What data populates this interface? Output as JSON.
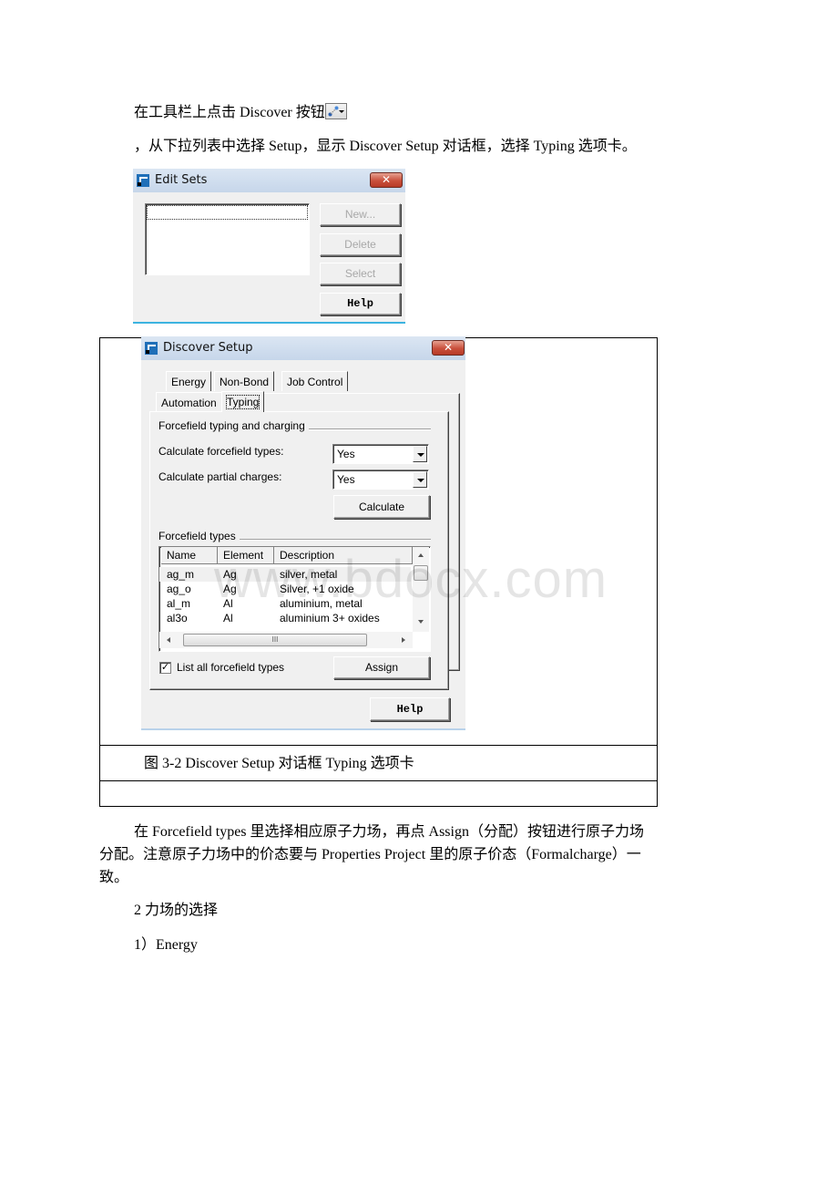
{
  "doc": {
    "para1": "在工具栏上点击 Discover 按钮",
    "para1_icon": "discover-toolbar-icon",
    "para2": "，从下拉列表中选择 Setup，显示 Discover Setup 对话框，选择 Typing 选项卡。",
    "caption": "图 3-2  Discover Setup 对话框 Typing 选项卡",
    "para3_line1": "在 Forcefield types 里选择相应原子力场，再点 Assign（分配）按钮进行原子力场",
    "para3_line2": "分配。注意原子力场中的价态要与 Properties Project 里的原子价态（Formalcharge）一",
    "para3_line3": "致。",
    "heading2": "2 力场的选择",
    "heading3": "1）Energy",
    "watermark": "www.bdocx.com"
  },
  "edit_sets": {
    "title": "Edit Sets",
    "close_glyph": "✕",
    "buttons": {
      "new": "New...",
      "delete": "Delete",
      "select": "Select",
      "help": "Help"
    }
  },
  "discover_setup": {
    "title": "Discover Setup",
    "close_glyph": "✕",
    "tabs_back": [
      "Energy",
      "Non-Bond",
      "Job Control"
    ],
    "tabs_front": [
      "Automation",
      "Typing"
    ],
    "selected_tab": "Typing",
    "group1_label": "Forcefield typing and charging",
    "calc_types_label": "Calculate forcefield types:",
    "calc_types_value": "Yes",
    "calc_charges_label": "Calculate partial charges:",
    "calc_charges_value": "Yes",
    "calculate_button": "Calculate",
    "group2_label": "Forcefield types",
    "columns": [
      "Name",
      "Element",
      "Description"
    ],
    "rows": [
      {
        "name": "ag_m",
        "element": "Ag",
        "description": "silver, metal"
      },
      {
        "name": "ag_o",
        "element": "Ag",
        "description": "Silver, +1 oxide"
      },
      {
        "name": "al_m",
        "element": "Al",
        "description": "aluminium, metal"
      },
      {
        "name": "al3o",
        "element": "Al",
        "description": "aluminium 3+ oxides"
      }
    ],
    "hscroll_grip": "III",
    "list_all_label": "List all forcefield types",
    "list_all_checked": true,
    "assign_button": "Assign",
    "help_button": "Help"
  }
}
